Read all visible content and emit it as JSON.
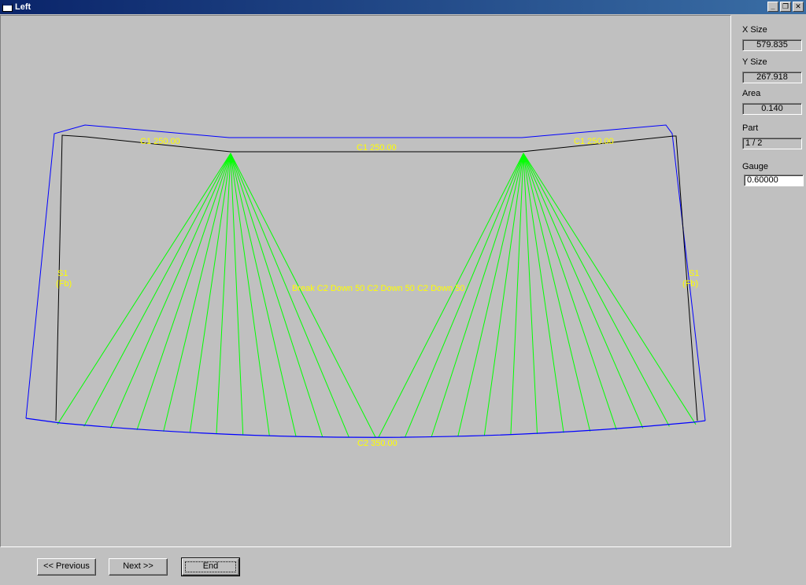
{
  "window": {
    "title": "Left"
  },
  "panel": {
    "x_size_label": "X Size",
    "x_size_value": "579.835",
    "y_size_label": "Y Size",
    "y_size_value": "267.918",
    "area_label": "Area",
    "area_value": "0.140",
    "part_label": "Part",
    "part_value": "1 / 2",
    "gauge_label": "Gauge",
    "gauge_value": "0.60000"
  },
  "drawing": {
    "top_left_label": "C1 250.00",
    "top_center_label": "C1 250.00",
    "top_right_label": "C1 250.00",
    "left_label_line1": "S1",
    "left_label_line2": "(Fb)",
    "right_label_line1": "S1",
    "right_label_line2": "(Fb)",
    "center_label": "Break C2 Down 50 C2 Down 50 C2 Down 50",
    "bottom_label": "C2 350.00",
    "colors": {
      "outline": "#0000ff",
      "inner": "#000000",
      "fan": "#00ff00",
      "text": "#ffff00"
    }
  },
  "buttons": {
    "previous": "<< Previous",
    "next": "Next >>",
    "end": "End"
  }
}
